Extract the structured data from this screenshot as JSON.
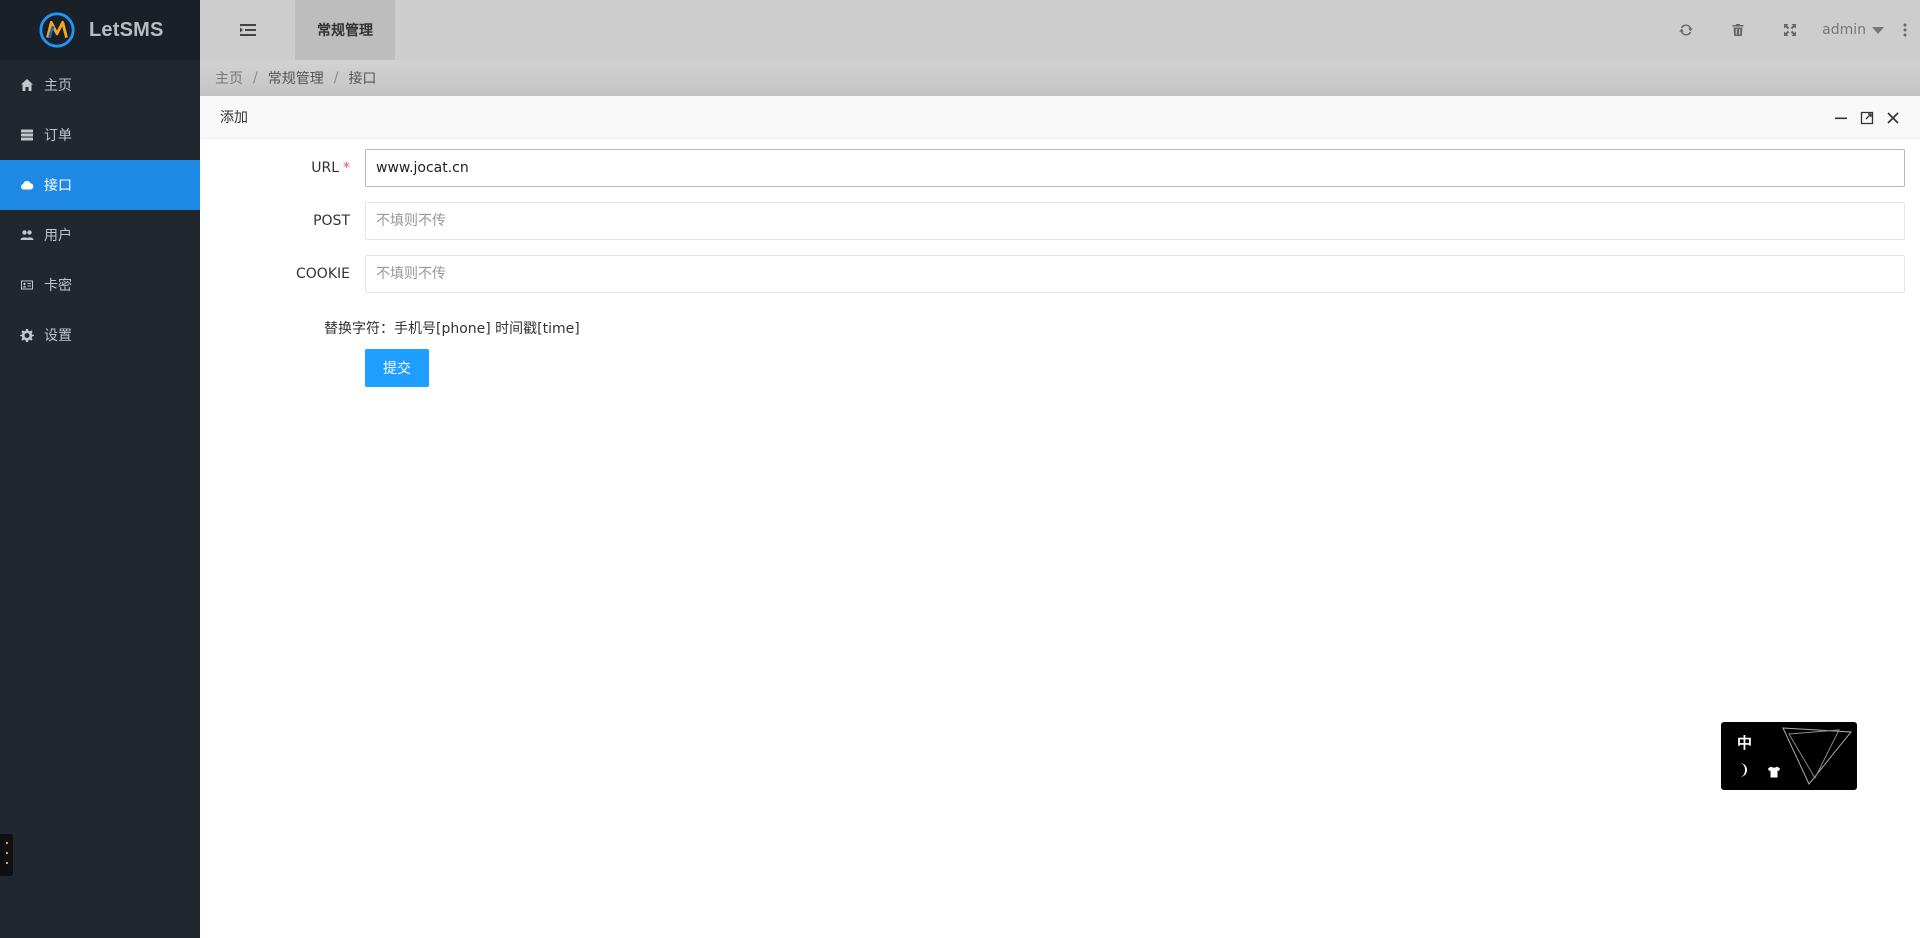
{
  "app": {
    "name": "LetSMS"
  },
  "sidebar": {
    "items": [
      {
        "label": "主页",
        "icon": "home-icon",
        "active": false
      },
      {
        "label": "订单",
        "icon": "server-icon",
        "active": false
      },
      {
        "label": "接口",
        "icon": "cloud-icon",
        "active": true
      },
      {
        "label": "用户",
        "icon": "users-icon",
        "active": false
      },
      {
        "label": "卡密",
        "icon": "id-card-icon",
        "active": false
      },
      {
        "label": "设置",
        "icon": "gear-icon",
        "active": false
      }
    ]
  },
  "header": {
    "tab_label": "常规管理",
    "user_label": "admin",
    "icons": [
      "refresh-icon",
      "trash-icon",
      "fullscreen-icon",
      "more-vertical-icon"
    ]
  },
  "breadcrumb": {
    "items": [
      "主页",
      "常规管理",
      "接口"
    ]
  },
  "dialog": {
    "title": "添加",
    "form": {
      "url": {
        "label": "URL",
        "value": "www.jocat.cn",
        "required": true
      },
      "post": {
        "label": "POST",
        "placeholder": "不填则不传"
      },
      "cookie": {
        "label": "COOKIE",
        "placeholder": "不填则不传"
      },
      "hint": "替换字符：手机号[phone] 时间戳[time]",
      "submit_label": "提交"
    }
  },
  "float_widget": {
    "lang_label": "中"
  },
  "colors": {
    "sidebar_bg": "#20272f",
    "active_item": "#1e88e5",
    "primary_button": "#1e9fff",
    "header_bg": "#cdcdcd"
  }
}
